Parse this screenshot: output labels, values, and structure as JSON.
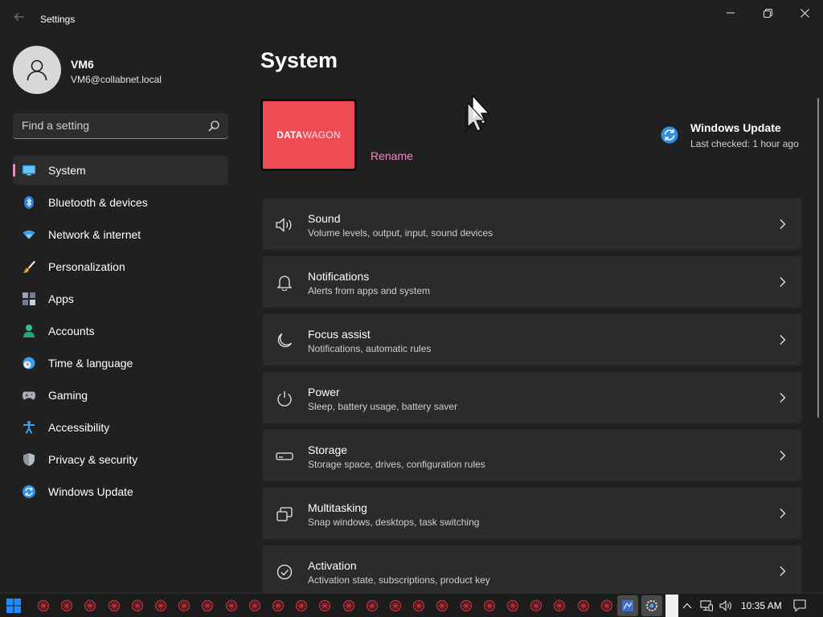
{
  "window": {
    "title": "Settings",
    "back_icon": "back-arrow-icon",
    "controls": [
      "minimize-icon",
      "maximize-icon",
      "close-icon"
    ]
  },
  "account": {
    "name": "VM6",
    "email": "VM6@collabnet.local"
  },
  "search": {
    "placeholder": "Find a setting",
    "value": ""
  },
  "nav": {
    "items": [
      {
        "label": "System",
        "icon": "system-display-icon",
        "selected": true
      },
      {
        "label": "Bluetooth & devices",
        "icon": "bluetooth-icon"
      },
      {
        "label": "Network & internet",
        "icon": "wifi-icon"
      },
      {
        "label": "Personalization",
        "icon": "paintbrush-icon"
      },
      {
        "label": "Apps",
        "icon": "apps-icon"
      },
      {
        "label": "Accounts",
        "icon": "person-icon"
      },
      {
        "label": "Time & language",
        "icon": "globe-clock-icon"
      },
      {
        "label": "Gaming",
        "icon": "gamepad-icon"
      },
      {
        "label": "Accessibility",
        "icon": "accessibility-icon"
      },
      {
        "label": "Privacy & security",
        "icon": "shield-icon"
      },
      {
        "label": "Windows Update",
        "icon": "windows-update-icon"
      }
    ]
  },
  "main": {
    "title": "System",
    "device": {
      "logo_part1": "DATA",
      "logo_part2": "WAGON",
      "rename_label": "Rename"
    },
    "windows_update": {
      "title": "Windows Update",
      "status": "Last checked: 1 hour ago"
    },
    "cards": [
      {
        "title": "Sound",
        "subtitle": "Volume levels, output, input, sound devices",
        "icon": "speaker-icon"
      },
      {
        "title": "Notifications",
        "subtitle": "Alerts from apps and system",
        "icon": "bell-icon"
      },
      {
        "title": "Focus assist",
        "subtitle": "Notifications, automatic rules",
        "icon": "moon-icon"
      },
      {
        "title": "Power",
        "subtitle": "Sleep, battery usage, battery saver",
        "icon": "power-icon"
      },
      {
        "title": "Storage",
        "subtitle": "Storage space, drives, configuration rules",
        "icon": "storage-drive-icon"
      },
      {
        "title": "Multitasking",
        "subtitle": "Snap windows, desktops, task switching",
        "icon": "multitasking-icon"
      },
      {
        "title": "Activation",
        "subtitle": "Activation state, subscriptions, product key",
        "icon": "check-circle-icon"
      }
    ]
  },
  "taskbar": {
    "clock": "10:35 AM",
    "app_icon_count": 25
  },
  "colors": {
    "accent": "#e98cc4",
    "background": "#202020",
    "card": "#2b2b2b",
    "device_tile": "#ef4b55"
  }
}
